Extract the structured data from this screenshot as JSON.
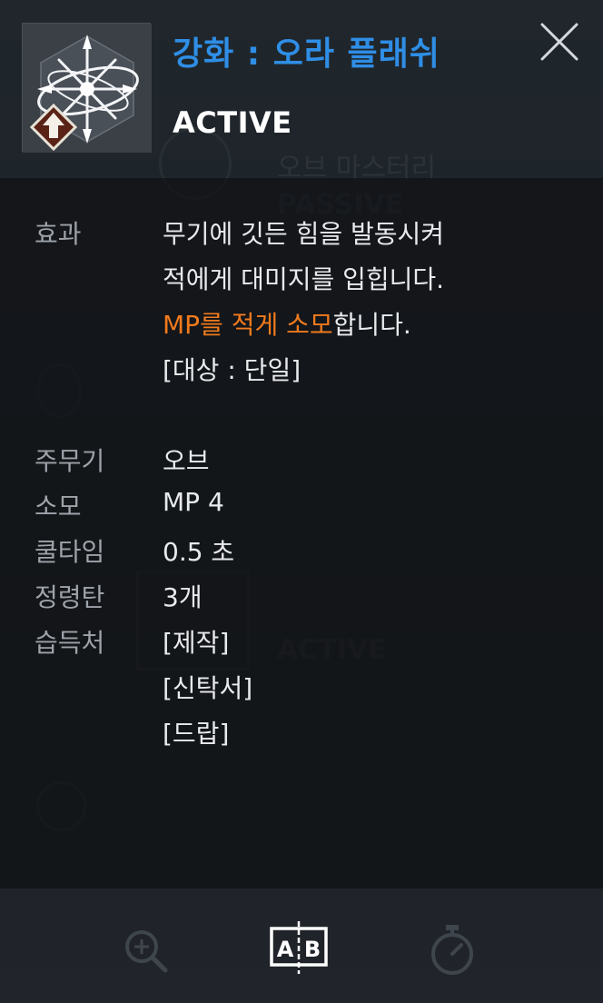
{
  "header": {
    "skill_name": "강화 : 오라 플래쉬",
    "skill_type": "ACTIVE"
  },
  "effect": {
    "label": "효과",
    "line1": "무기에 깃든 힘을 발동시켜",
    "line2": "적에게 대미지를 입힙니다.",
    "line3_highlight": "MP를 적게 소모",
    "line3_rest": "합니다.",
    "line4": "[대상 : 단일]"
  },
  "stats": {
    "weapon_label": "주무기",
    "weapon_value": "오브",
    "cost_label": "소모",
    "cost_value": "MP 4",
    "cooldown_label": "쿨타임",
    "cooldown_value": "0.5 초",
    "spirit_label": "정령탄",
    "spirit_value": "3개",
    "source_label": "습득처",
    "sources": [
      "[제작]",
      "[신탁서]",
      "[드랍]"
    ]
  },
  "background": {
    "ghost_title": "오브 마스터리",
    "ghost_passive": "PASSIVE",
    "ghost_active": "ACTIVE"
  },
  "toolbar": {
    "compare_label_a": "A",
    "compare_label_b": "B"
  },
  "icons": {
    "close": "close-icon",
    "zoom": "zoom-in-icon",
    "compare": "compare-ab-icon",
    "timer": "stopwatch-icon"
  },
  "colors": {
    "title_blue": "#2f8ee6",
    "highlight_orange": "#f07a1e",
    "label_gray": "#9da3a9",
    "value_white": "#e8eaec"
  }
}
